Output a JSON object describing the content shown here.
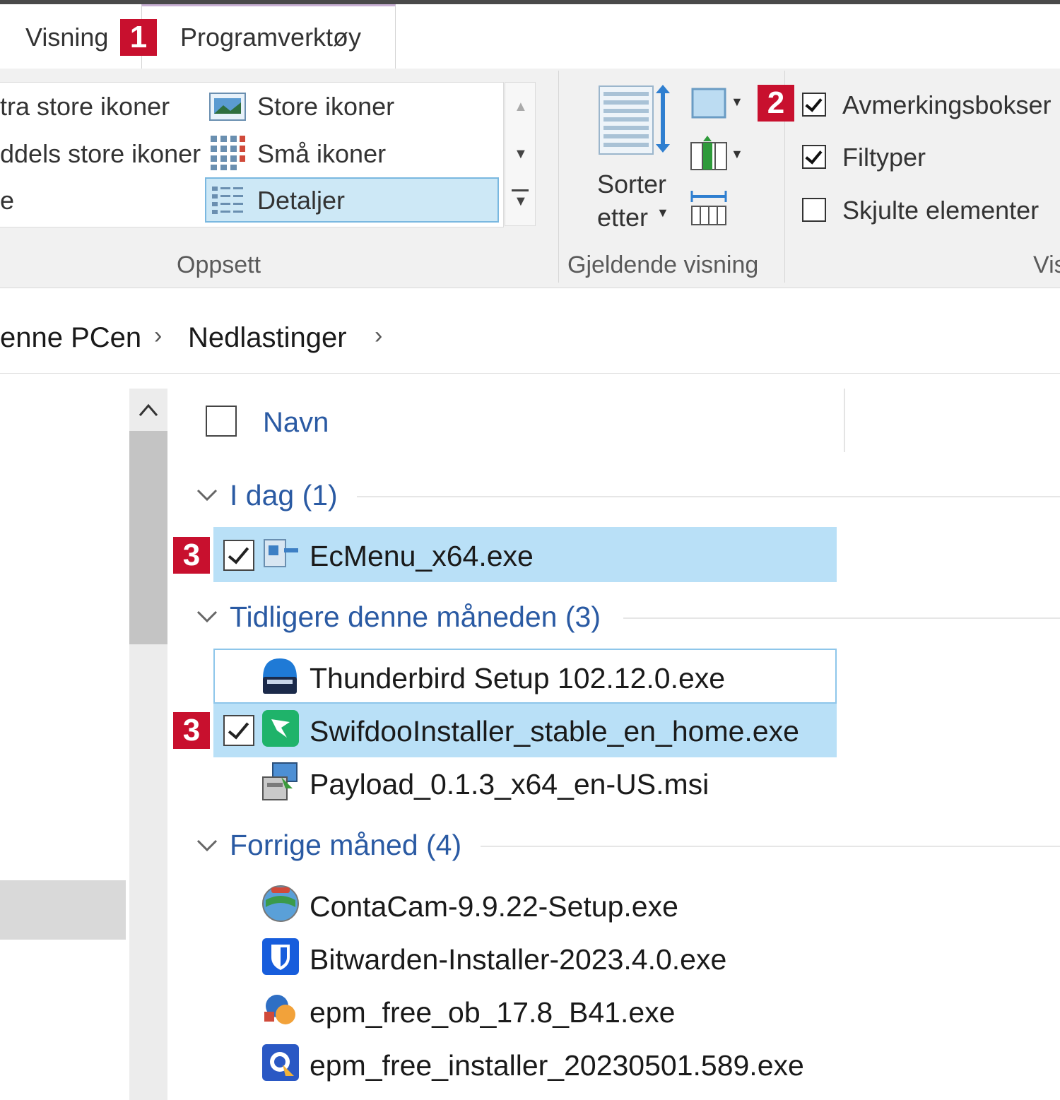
{
  "ribbon": {
    "tabs": {
      "visning": "Visning",
      "programverktoy": "Programverktøy"
    },
    "markers": {
      "m1": "1",
      "m2": "2",
      "m3a": "3",
      "m3b": "3"
    },
    "layout": {
      "items": {
        "ekstra_store": "tra store ikoner",
        "store": "Store ikoner",
        "middels": "ddels store ikoner",
        "sma": "Små ikoner",
        "liste": "e",
        "detaljer": "Detaljer"
      },
      "group_label": "Oppsett"
    },
    "current_view": {
      "sort_line1": "Sorter",
      "sort_line2": "etter",
      "group_label": "Gjeldende visning"
    },
    "show_hide": {
      "checkboxes": [
        {
          "label": "Avmerkingsbokser",
          "checked": true
        },
        {
          "label": "Filtyper",
          "checked": true
        },
        {
          "label": "Skjulte elementer",
          "checked": false
        }
      ],
      "group_label": "Vis"
    }
  },
  "address": {
    "crumbs": [
      "enne PCen",
      "Nedlastinger"
    ]
  },
  "list": {
    "column_header": "Navn",
    "groups": [
      {
        "title": "I dag (1)",
        "files": [
          "EcMenu_x64.exe"
        ]
      },
      {
        "title": "Tidligere denne måneden (3)",
        "files": [
          "Thunderbird Setup 102.12.0.exe",
          "SwifdooInstaller_stable_en_home.exe",
          "Payload_0.1.3_x64_en-US.msi"
        ]
      },
      {
        "title": "Forrige måned (4)",
        "files": [
          "ContaCam-9.9.22-Setup.exe",
          "Bitwarden-Installer-2023.4.0.exe",
          "epm_free_ob_17.8_B41.exe",
          "epm_free_installer_20230501.589.exe"
        ]
      }
    ]
  },
  "colors": {
    "accent": "#2a5aa3",
    "marker": "#c8102e",
    "selection": "#b9e0f7"
  }
}
